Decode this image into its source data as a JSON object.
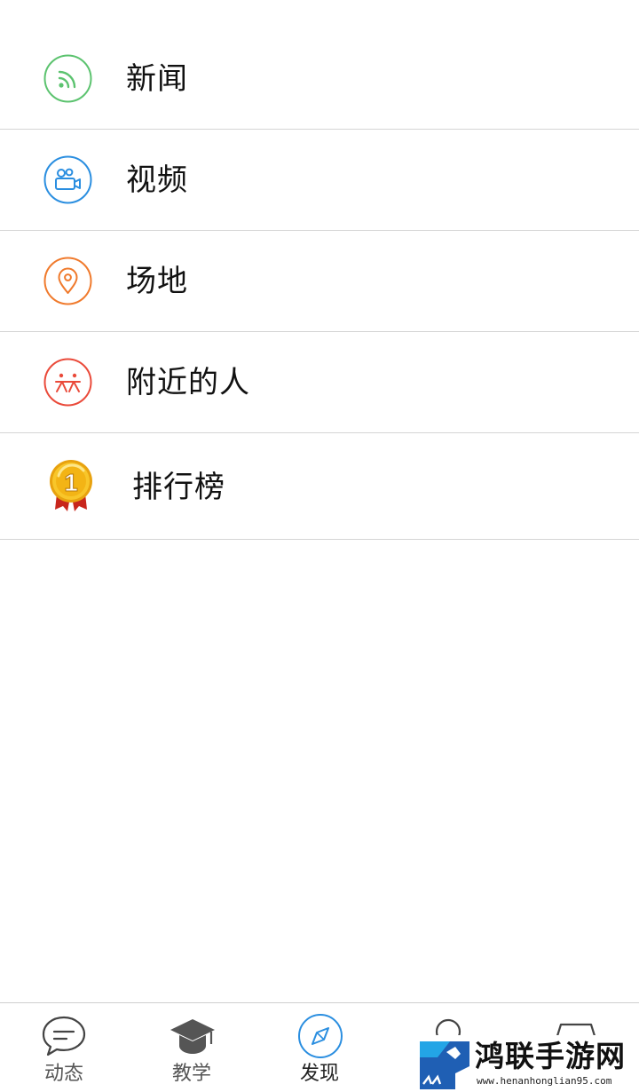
{
  "menu": {
    "items": [
      {
        "label": "新闻",
        "icon": "rss-icon",
        "color": "#5cc36f"
      },
      {
        "label": "视频",
        "icon": "video-camera-icon",
        "color": "#2a8ee0"
      },
      {
        "label": "场地",
        "icon": "location-pin-icon",
        "color": "#f07a2c"
      },
      {
        "label": "附近的人",
        "icon": "nearby-people-icon",
        "color": "#ea4a3a"
      },
      {
        "label": "排行榜",
        "icon": "first-place-medal-icon",
        "color": "#f2b51b"
      }
    ]
  },
  "tabbar": {
    "tabs": [
      {
        "label": "动态",
        "icon": "chat-bubble-icon",
        "active": false
      },
      {
        "label": "教学",
        "icon": "graduation-cap-icon",
        "active": false
      },
      {
        "label": "发现",
        "icon": "compass-icon",
        "active": true
      },
      {
        "label": "",
        "icon": "person-icon",
        "active": false
      },
      {
        "label": "",
        "icon": "bag-icon",
        "active": false
      }
    ],
    "active_color": "#2a8ee0"
  },
  "watermark": {
    "text": "鸿联手游网",
    "url": "www.henanhonglian95.com"
  }
}
